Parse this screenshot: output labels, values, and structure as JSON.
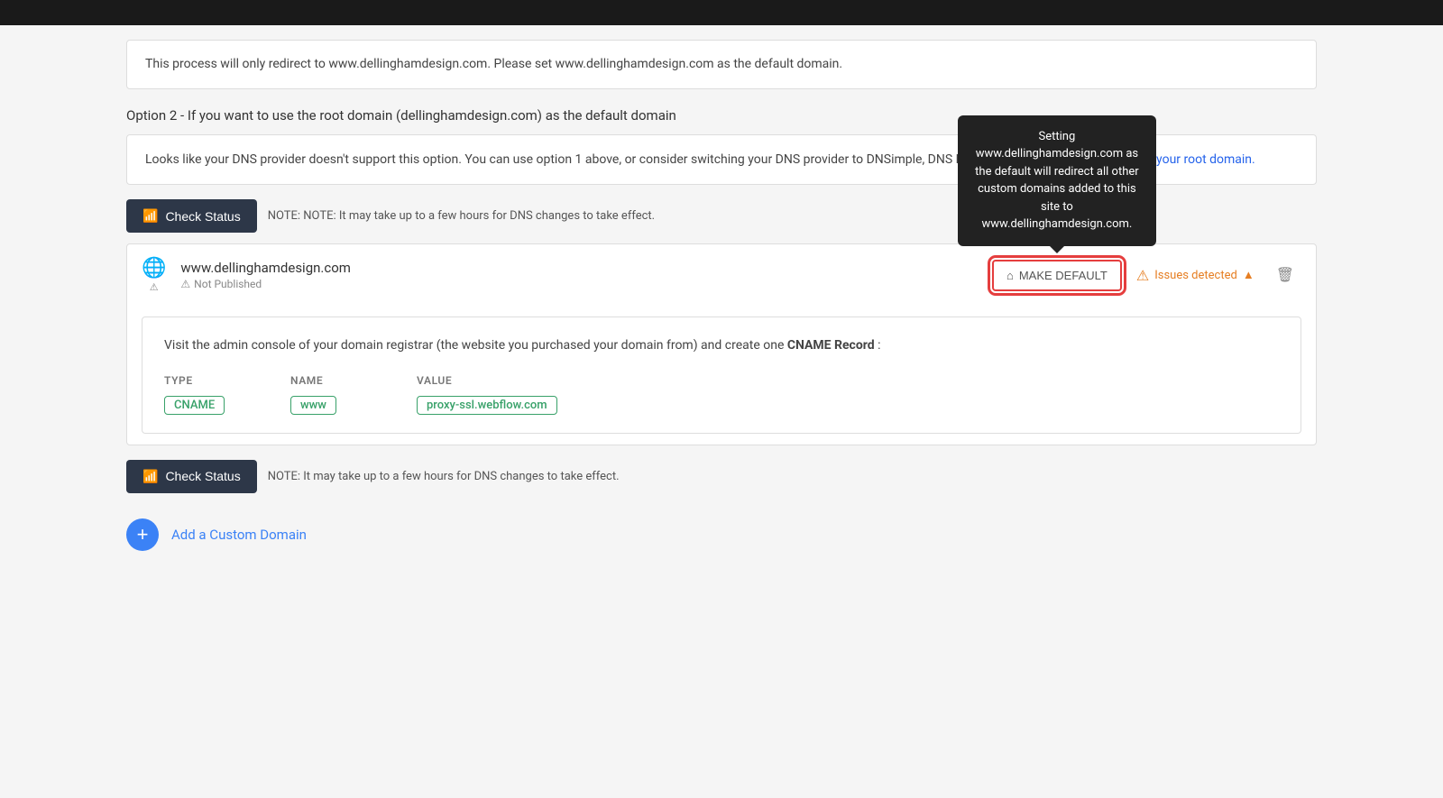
{
  "topBar": {},
  "redirect_notice": {
    "text": "This process will only redirect to www.dellinghamdesign.com. Please set www.dellinghamdesign.com as the default domain."
  },
  "option2": {
    "heading": "Option 2 - If you want to use the root domain (dellinghamdesign.com) as the default domain"
  },
  "warning_box": {
    "text_before_link": "Looks like your DNS provider doesn't support this option. You can use option 1 above, or consider switching your DNS provider to DNSimple, DNS Made Easy, or Cloudflare. Le",
    "link_text": "SSL on your root domain.",
    "link_suffix": ""
  },
  "check_status_1": {
    "label": "Check Status"
  },
  "note_1": {
    "text": "NOTE: It may take up to a few hours for DNS changes to take effect."
  },
  "domain_row": {
    "domain": "www.dellinghamdesign.com",
    "status": "Not Published"
  },
  "tooltip": {
    "title": "Setting www.dellinghamdesign.com as the default will redirect all other custom domains added to this site to www.dellinghamdesign.com."
  },
  "make_default_btn": {
    "label": "MAKE DEFAULT"
  },
  "issues_detected": {
    "label": "Issues detected",
    "chevron": "▲"
  },
  "cname_box": {
    "intro_before": "Visit the admin console of your domain registrar (the website you purchased your domain from) and create one ",
    "intro_bold": "CNAME Record",
    "intro_after": " :",
    "headers": {
      "type": "TYPE",
      "name": "NAME",
      "value": "VALUE"
    },
    "row": {
      "type": "CNAME",
      "name": "www",
      "value": "proxy-ssl.webflow.com"
    }
  },
  "check_status_2": {
    "label": "Check Status"
  },
  "note_2": {
    "text": "NOTE: It may take up to a few hours for DNS changes to take effect."
  },
  "add_domain": {
    "label": "Add a Custom Domain",
    "plus": "+"
  }
}
